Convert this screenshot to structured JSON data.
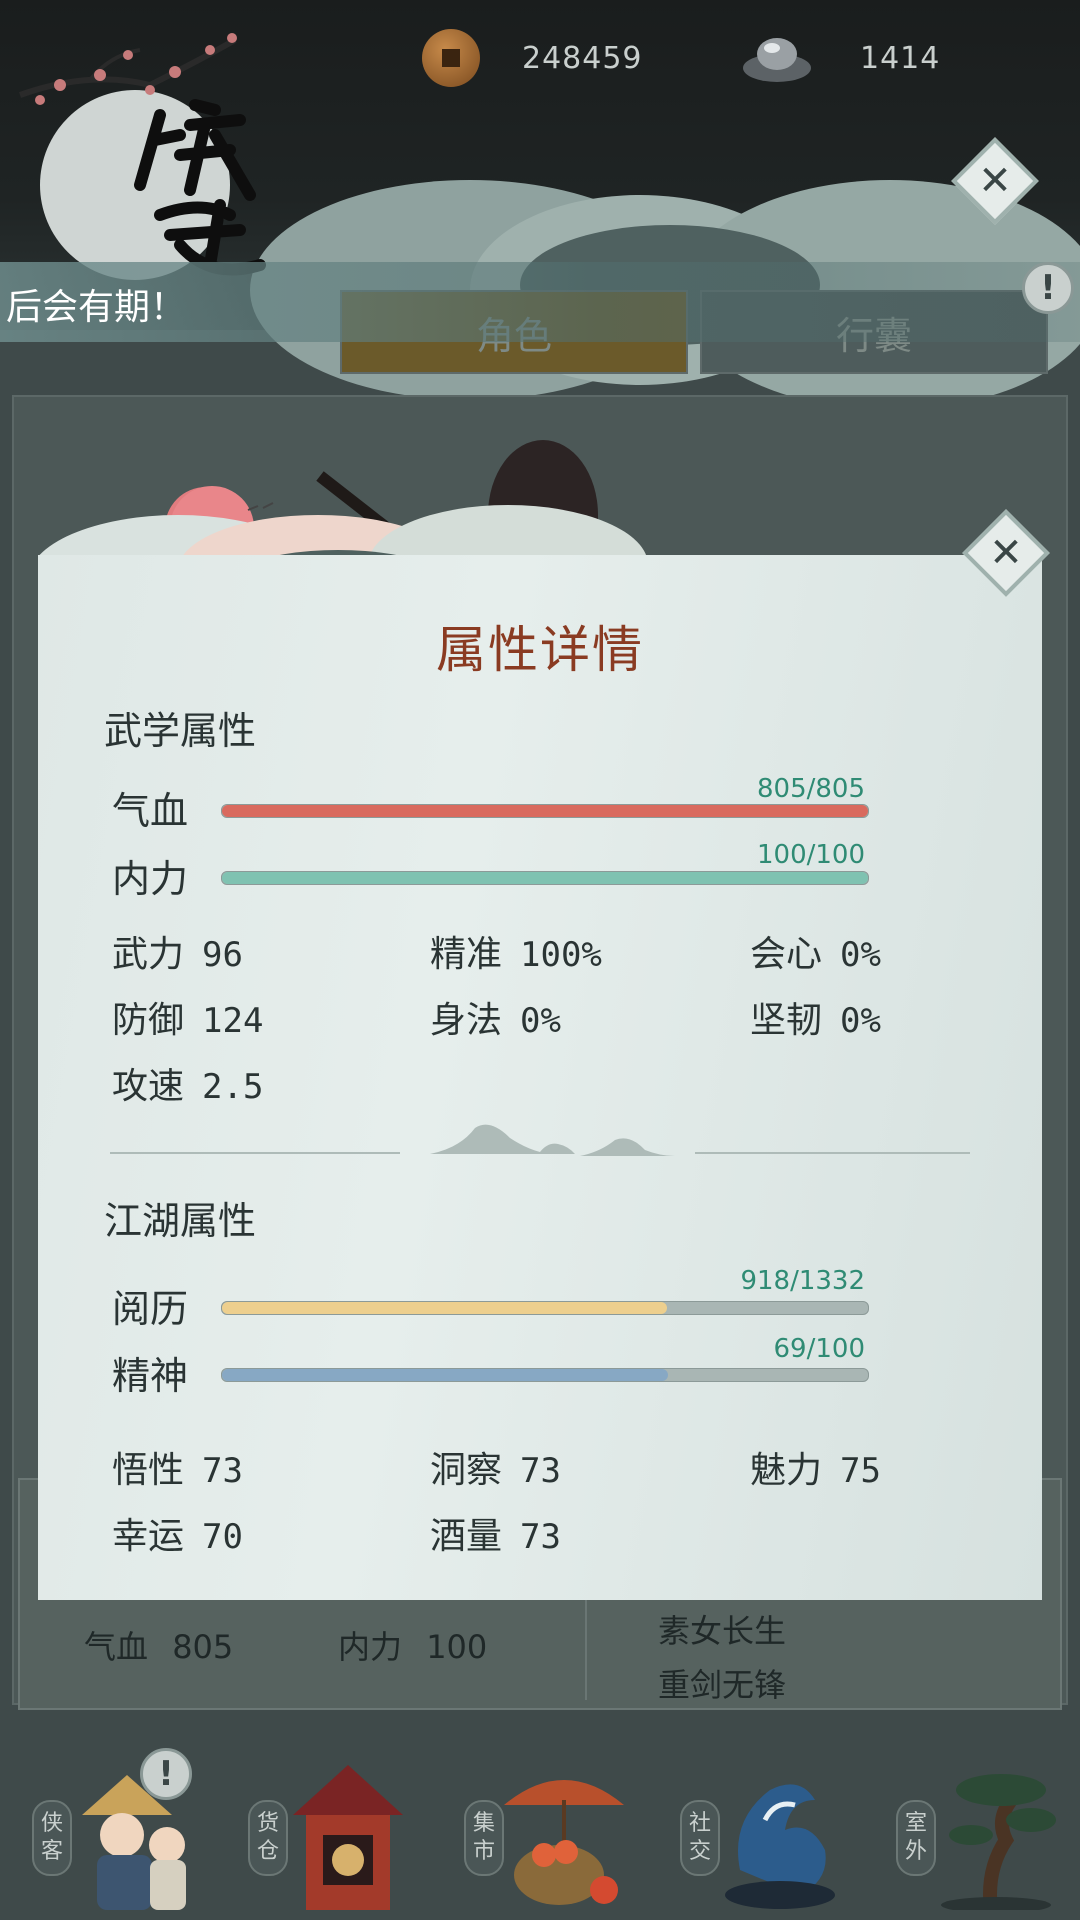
{
  "wallet": {
    "copper_coins": "248459",
    "silver_ingots": "1414"
  },
  "notice": {
    "text": "后会有期！"
  },
  "tabs": [
    {
      "label": "角色"
    },
    {
      "label": "行囊"
    }
  ],
  "modal": {
    "title": "属性详情",
    "martial": {
      "title": "武学属性",
      "hp": {
        "label": "气血",
        "value": "805/805",
        "fill": 1.0,
        "color": "#d96a5e"
      },
      "mana": {
        "label": "内力",
        "value": "100/100",
        "fill": 1.0,
        "color": "#7fc2b1"
      },
      "stats": [
        {
          "label": "武力",
          "value": "96"
        },
        {
          "label": "精准",
          "value": "100%"
        },
        {
          "label": "会心",
          "value": "0%"
        },
        {
          "label": "防御",
          "value": "124"
        },
        {
          "label": "身法",
          "value": "0%"
        },
        {
          "label": "坚韧",
          "value": "0%"
        },
        {
          "label": "攻速",
          "value": "2.5"
        }
      ]
    },
    "jianghu": {
      "title": "江湖属性",
      "exp": {
        "label": "阅历",
        "value": "918/1332",
        "fill": 0.689,
        "color": "#edcf8e"
      },
      "spirit": {
        "label": "精神",
        "value": "69/100",
        "fill": 0.69,
        "color": "#87a8c4"
      },
      "stats": [
        {
          "label": "悟性",
          "value": "73"
        },
        {
          "label": "洞察",
          "value": "73"
        },
        {
          "label": "魅力",
          "value": "75"
        },
        {
          "label": "幸运",
          "value": "70"
        },
        {
          "label": "酒量",
          "value": "73"
        }
      ]
    }
  },
  "summary": {
    "hp_label": "气血",
    "hp_value": "805",
    "mana_label": "内力",
    "mana_value": "100",
    "skills": [
      "素女长生",
      "重剑无锋"
    ]
  },
  "nav": [
    {
      "label": "侠客"
    },
    {
      "label": "货仓"
    },
    {
      "label": "集市"
    },
    {
      "label": "社交"
    },
    {
      "label": "室外"
    }
  ],
  "icons": {
    "close": "close-icon",
    "alert": "alert-icon",
    "coin": "copper-coin-icon",
    "ingot": "silver-ingot-icon"
  }
}
